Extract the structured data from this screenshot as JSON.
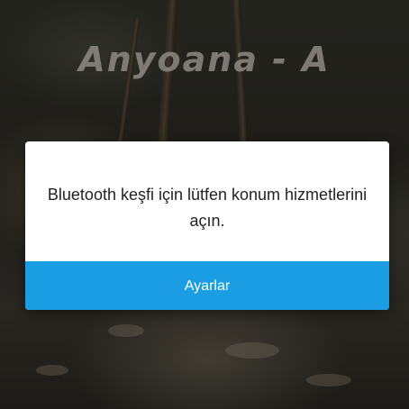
{
  "background": {
    "logo_text": "Anyoana - A"
  },
  "dialog": {
    "message": "Bluetooth keşfi için lütfen konum hizmetlerini açın.",
    "button_label": "Ayarlar"
  },
  "colors": {
    "accent": "#1a9de3",
    "dialog_bg": "#ffffff",
    "message_text": "#222222"
  }
}
